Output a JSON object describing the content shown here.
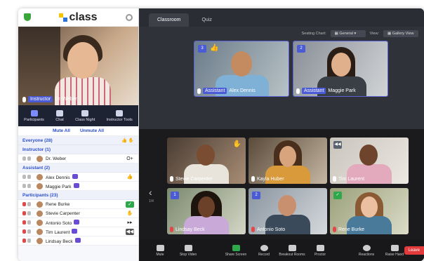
{
  "app": {
    "brand": "class"
  },
  "host": {
    "role": "Instructor",
    "name": "Dr. Weber"
  },
  "tools": [
    {
      "label": "Participants",
      "icon": "participants-icon",
      "active": true
    },
    {
      "label": "Chat",
      "icon": "chat-icon",
      "active": false
    },
    {
      "label": "Class Night",
      "icon": "class-night-icon",
      "active": false
    },
    {
      "label": "Instructor Tools",
      "icon": "instructor-tools-icon",
      "active": false
    }
  ],
  "mute": {
    "mute_all": "Mute All",
    "unmute_all": "Unmute All"
  },
  "sections": {
    "everyone": "Everyone (28)",
    "instructor": "Instructor (1)",
    "assistant": "Assistant (2)",
    "participants": "Participants (23)"
  },
  "instructor_rows": [
    {
      "name": "Dr. Weber",
      "status": "O+"
    }
  ],
  "assistant_rows": [
    {
      "name": "Alex Dennis",
      "status": "👍"
    },
    {
      "name": "Maggie Park",
      "status": ""
    }
  ],
  "participant_rows": [
    {
      "name": "Rene Burke",
      "status": "✓"
    },
    {
      "name": "Stevie Carpenter",
      "status": "✋"
    },
    {
      "name": "Antonio Soto",
      "status": "▸▸"
    },
    {
      "name": "Tim Laurent",
      "status": "◀◀"
    },
    {
      "name": "Lindsay Beck",
      "status": ""
    }
  ],
  "tabs": [
    "Classroom",
    "Quiz"
  ],
  "seating": {
    "label": "Seating Chart:",
    "value": "General",
    "view_label": "View:",
    "view_value": "Gallery View"
  },
  "stage": [
    {
      "num": "3",
      "role": "Assistant",
      "name": "Alex Dennis"
    },
    {
      "num": "2",
      "role": "Assistant",
      "name": "Maggie Park"
    }
  ],
  "gallery": [
    {
      "name": "Stevie Carpenter",
      "badge": "✋"
    },
    {
      "name": "Kayla Huber",
      "badge": ""
    },
    {
      "name": "Tim Laurent",
      "badge": "◀◀"
    },
    {
      "name": "Lindsay Beck",
      "badge": "1"
    },
    {
      "name": "Antonio Soto",
      "badge": "2"
    },
    {
      "name": "Rene Burke",
      "badge": "✓"
    }
  ],
  "page_indicator": "1/4",
  "bottom": [
    "Mute",
    "Stop Video",
    "Share Screen",
    "Record",
    "Breakout Rooms",
    "Proctor",
    "Reactions",
    "Raise Hand"
  ],
  "leave": "Leave"
}
